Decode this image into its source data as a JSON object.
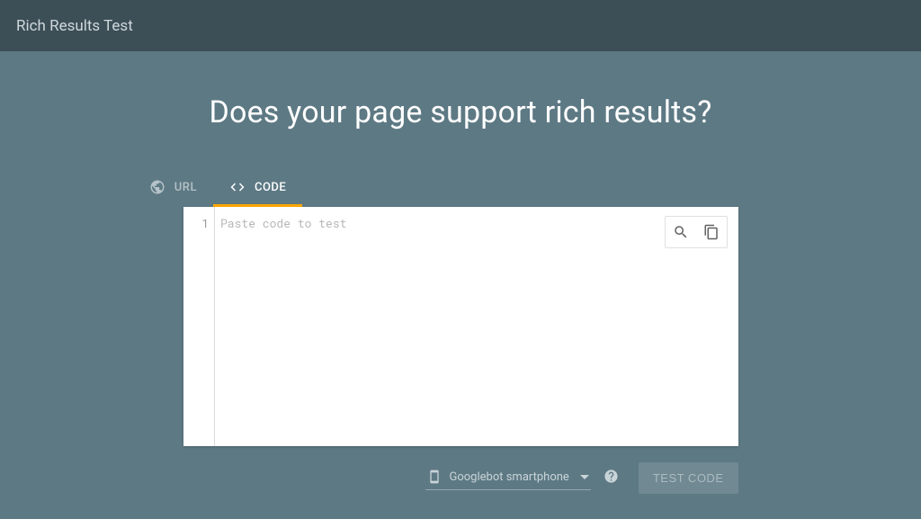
{
  "header": {
    "title": "Rich Results Test"
  },
  "main": {
    "headline": "Does your page support rich results?",
    "tabs": [
      {
        "label": "URL",
        "active": false
      },
      {
        "label": "CODE",
        "active": true
      }
    ]
  },
  "editor": {
    "placeholder": "Paste code to test",
    "line_number": "1"
  },
  "footer": {
    "device_label": "Googlebot smartphone",
    "submit_label": "TEST CODE"
  }
}
